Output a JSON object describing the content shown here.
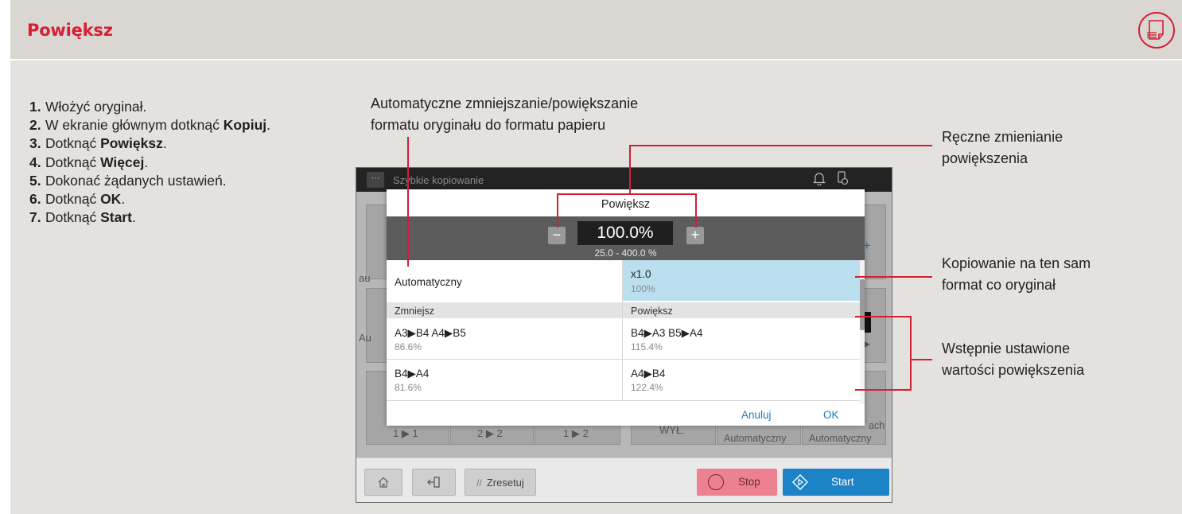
{
  "page": {
    "title": "Powiększ",
    "accent_color": "#d51f34",
    "header_icon": "document-icon"
  },
  "steps": [
    {
      "num": "1.",
      "text": "Włożyć oryginał.",
      "bold": ""
    },
    {
      "num": "2.",
      "text": "W ekranie głównym dotknąć ",
      "bold": "Kopiuj"
    },
    {
      "num": "3.",
      "text": "Dotknąć ",
      "bold": "Powiększ"
    },
    {
      "num": "4.",
      "text": "Dotknąć ",
      "bold": "Więcej"
    },
    {
      "num": "5.",
      "text": "Dokonać żądanych ustawień.",
      "bold": ""
    },
    {
      "num": "6.",
      "text": "Dotknąć ",
      "bold": "OK"
    },
    {
      "num": "7.",
      "text": "Dotknąć ",
      "bold": "Start"
    }
  ],
  "annotations": {
    "auto": "Automatyczne zmniejszanie/powiększanie\nformatu oryginału do formatu papieru",
    "manual": "Ręczne zmienianie\npowiększenia",
    "same_size": "Kopiowanie na ten sam\nformat co oryginał",
    "presets": "Wstępnie ustawione\nwartości powiększenia"
  },
  "screen": {
    "app_title": "Szybkie kopiowanie",
    "menu_glyph": "···",
    "bell_icon": "bell-icon",
    "device_icon": "device-status-icon",
    "bg_labels": {
      "left_top": "au",
      "left_mid": "Au",
      "row_a": "1 ▶ 1",
      "row_b": "2 ▶ 2",
      "row_c": "1 ▶ 2",
      "row_d": "WYŁ.",
      "row_e": "Automatyczny",
      "row_f": "Automatyczny",
      "row_g": "ach",
      "plus": "+",
      "arrow": "▶",
      "dots": "..."
    },
    "bottom": {
      "home_icon": "home-icon",
      "logout_icon": "logout-icon",
      "reset_label": "Zresetuj",
      "stop_label": "Stop",
      "start_label": "Start"
    }
  },
  "dialog": {
    "title": "Powiększ",
    "zoom_value": "100.0%",
    "zoom_range": "25.0  -  400.0  %",
    "minus": "−",
    "plus": "+",
    "auto_label": "Automatyczny",
    "same_main": "x1.0",
    "same_sub": "100%",
    "reduce_header": "Zmniejsz",
    "enlarge_header": "Powiększ",
    "reduce": [
      {
        "main": "A3▶B4  A4▶B5",
        "sub": "86.6%"
      },
      {
        "main": "B4▶A4",
        "sub": "81.6%"
      }
    ],
    "enlarge": [
      {
        "main": "B4▶A3  B5▶A4",
        "sub": "115.4%"
      },
      {
        "main": "A4▶B4",
        "sub": "122.4%"
      }
    ],
    "cancel_label": "Anuluj",
    "ok_label": "OK",
    "selected_color": "#bcdff0"
  }
}
